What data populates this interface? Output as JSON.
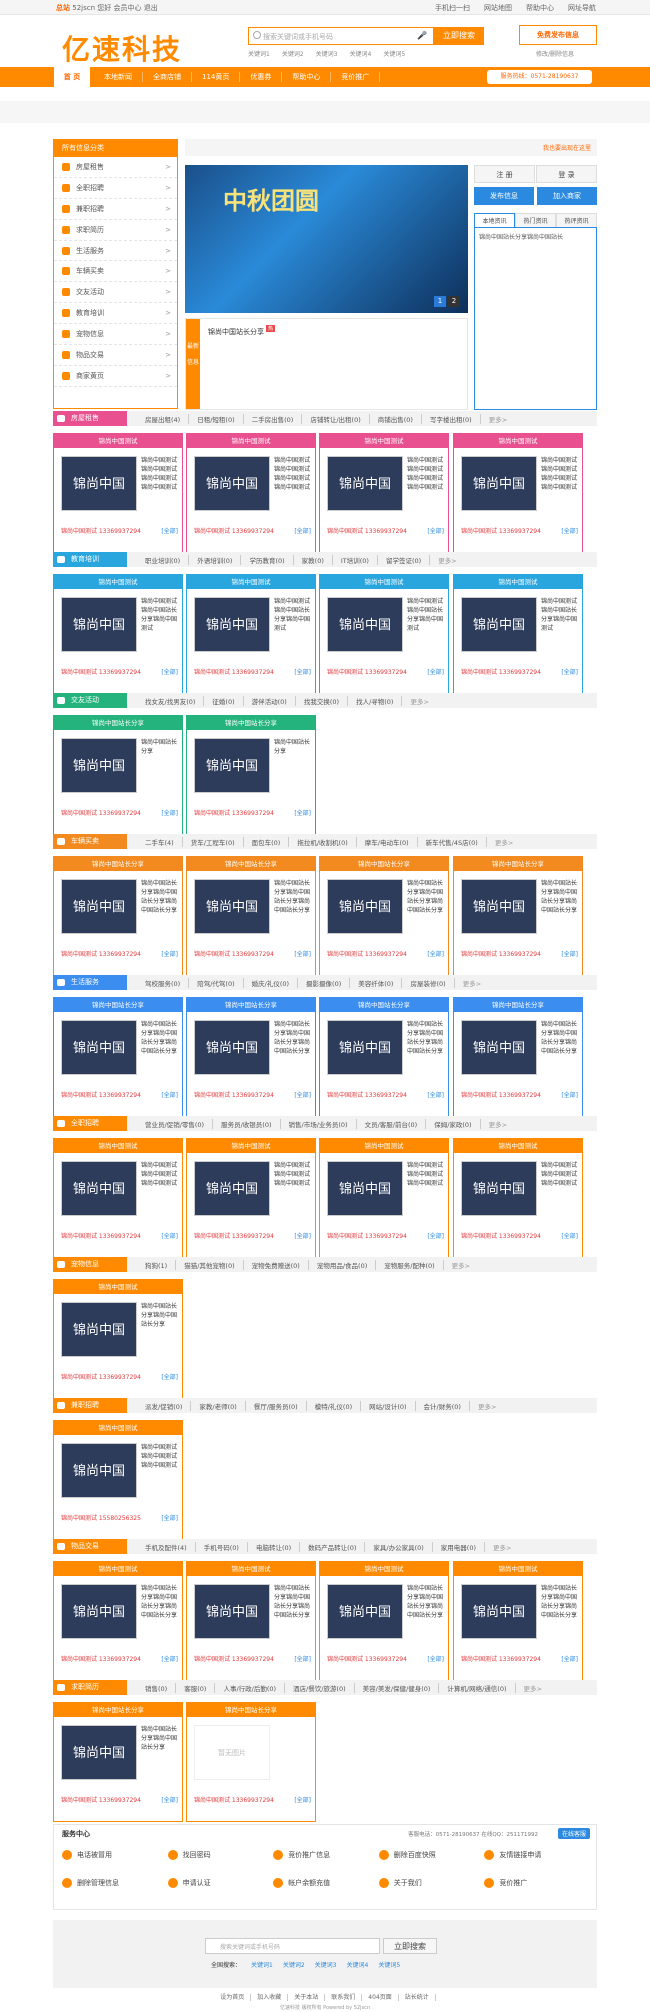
{
  "topbar": {
    "site": "总站",
    "left_text": "52jscn 您好 会员中心 退出",
    "links": [
      "手机扫一扫",
      "网站地图",
      "帮助中心",
      "网址导航"
    ]
  },
  "logo": "亿速科技",
  "search": {
    "placeholder": "搜索关键词或手机号码",
    "button": "立即搜索",
    "hot": [
      "关键词1",
      "关键词2",
      "关键词3",
      "关键词4",
      "关键词5"
    ]
  },
  "publish": {
    "label": "免费发布信息",
    "sub": "修改/删除信息"
  },
  "nav": {
    "home": "首 页",
    "items": [
      "本地新闻",
      "全商店铺",
      "114黄页",
      "优惠券",
      "帮助中心",
      "竞价推广"
    ],
    "tel": "服务热线：0571-28190637"
  },
  "sidebar": {
    "title": "所有信息分类",
    "items": [
      "房屋租售",
      "全职招聘",
      "兼职招聘",
      "求职简历",
      "生活服务",
      "车辆买卖",
      "交友活动",
      "教育培训",
      "宠物信息",
      "物品交易",
      "商家黄页"
    ]
  },
  "location": "我也要出现在这里",
  "banner": {
    "headline": "中秋团圆",
    "pages": [
      "1",
      "2"
    ]
  },
  "news": {
    "tab": "最新信息",
    "item": "锦尚中国站长分享",
    "badge": "热"
  },
  "rightbox": {
    "login": "注 册",
    "register": "登 录",
    "post": "发布信息",
    "join": "加入商家",
    "tabs": [
      "本地资讯",
      "热门资讯",
      "热评资讯"
    ],
    "list_item": "锦尚中国站长分享锦尚中国站长"
  },
  "sections": [
    {
      "title": "房屋租售",
      "color": "#e8508f",
      "subs": [
        "房屋出租(4)",
        "日租/短租(0)",
        "二手房出售(0)",
        "店铺转让/出租(0)",
        "商铺出售(0)",
        "写字楼出租(0)"
      ],
      "cards": 4,
      "header": "锦尚中国测试",
      "desc": "锦尚中国测试锦尚中国测试锦尚中国测试锦尚中国测试",
      "contact": "锦尚中国测试 13369937294"
    },
    {
      "title": "教育培训",
      "color": "#2aa6df",
      "subs": [
        "职业培训(0)",
        "外语培训(0)",
        "学历教育(0)",
        "家教(0)",
        "IT培训(0)",
        "留学签证(0)"
      ],
      "cards": 4,
      "header": "锦尚中国测试",
      "desc": "锦尚中国测试锦尚中国站长分享锦尚中国测试",
      "contact": "锦尚中国测试 13369937294"
    },
    {
      "title": "交友活动",
      "color": "#24b37c",
      "subs": [
        "找女友/找男友(0)",
        "征婚(0)",
        "游伴活动(0)",
        "找我交换(0)",
        "找人/寻物(0)"
      ],
      "cards": 2,
      "header": "锦尚中国站长分享",
      "desc": "锦尚中国站长分享",
      "contact": "锦尚中国测试 13369937294"
    },
    {
      "title": "车辆买卖",
      "color": "#f28a1f",
      "subs": [
        "二手车(4)",
        "货车/工程车(0)",
        "面包车(0)",
        "拖拉机/收割机(0)",
        "摩车/电动车(0)",
        "新车代售/4S店(0)"
      ],
      "cards": 4,
      "header": "锦尚中国站长分享",
      "desc": "锦尚中国站长分享锦尚中国站长分享锦尚中国站长分享",
      "contact": "锦尚中国测试 13369937294"
    },
    {
      "title": "生活服务",
      "color": "#3b8ef0",
      "subs": [
        "驾校服务(0)",
        "陪驾/代驾(0)",
        "婚庆/礼仪(0)",
        "摄影摄像(0)",
        "美容纤体(0)",
        "房屋装修(0)"
      ],
      "cards": 4,
      "header": "锦尚中国站长分享",
      "desc": "锦尚中国站长分享锦尚中国站长分享锦尚中国站长分享",
      "contact": "锦尚中国测试 13369937294"
    },
    {
      "title": "全职招聘",
      "color": "#ff8a00",
      "subs": [
        "营业员/促销/零售(0)",
        "服务员/收银员(0)",
        "销售/市场/业务员(0)",
        "文员/客服/前台(0)",
        "保姆/家政(0)"
      ],
      "cards": 4,
      "header": "锦尚中国测试",
      "desc": "锦尚中国测试锦尚中国测试锦尚中国测试",
      "contact": "锦尚中国测试 13369937294"
    },
    {
      "title": "宠物信息",
      "color": "#ff8a00",
      "subs": [
        "狗狗(1)",
        "猫猫/其他宠物(0)",
        "宠物免费赠送(0)",
        "宠物用品/食品(0)",
        "宠物服务/配种(0)"
      ],
      "cards": 1,
      "header": "锦尚中国测试",
      "desc": "锦尚中国站长分享锦尚中国站长分享",
      "contact": "锦尚中国测试 13369937294"
    },
    {
      "title": "兼职招聘",
      "color": "#ff8a00",
      "subs": [
        "派发/促销(0)",
        "家教/老师(0)",
        "餐厅/服务员(0)",
        "模特/礼仪(0)",
        "网站/设计(0)",
        "会计/财务(0)"
      ],
      "cards": 1,
      "header": "锦尚中国测试",
      "desc": "锦尚中国测试锦尚中国测试锦尚中国测试",
      "contact": "锦尚中国测试 15580256325"
    },
    {
      "title": "物品交易",
      "color": "#ff8a00",
      "subs": [
        "手机及配件(4)",
        "手机号码(0)",
        "电脑转让(0)",
        "数码产品转让(0)",
        "家具/办公家具(0)",
        "家用电器(0)"
      ],
      "cards": 4,
      "header": "锦尚中国测试",
      "desc": "锦尚中国站长分享锦尚中国站长分享锦尚中国站长分享",
      "contact": "锦尚中国测试 13369937294"
    },
    {
      "title": "求职简历",
      "color": "#ff8a00",
      "subs": [
        "销售(0)",
        "客服(0)",
        "人事/行政/后勤(0)",
        "酒店/餐饮/旅游(0)",
        "美容/美发/保健/健身(0)",
        "计算机/网络/通信(0)"
      ],
      "cards": 2,
      "header": "锦尚中国站长分享",
      "desc": "锦尚中国站长分享锦尚中国站长分享",
      "contact": "锦尚中国测试 13369937294"
    }
  ],
  "card_image_text": "锦尚中国",
  "placeholder_text": "暂无图片",
  "all_label": "[全部]",
  "service": {
    "title": "服务中心",
    "tel": "客服电话：0571-28190637  在线QQ：251171992",
    "kefu": "在线客服",
    "items": [
      "电话被冒用",
      "找回密码",
      "竞价推广信息",
      "删除百度快照",
      "友情链接申请",
      "删除管理信息",
      "申请认证",
      "帐户余额充值",
      "关于我们",
      "竞价推广"
    ]
  },
  "footer": {
    "placeholder": "搜索关键词或手机号码",
    "button": "立即搜索",
    "hot_label": "全国搜索：",
    "hot": [
      "关键词1",
      "关键词2",
      "关键词3",
      "关键词4",
      "关键词5"
    ],
    "links": [
      "设为首页",
      "加入收藏",
      "关于本站",
      "联系我们",
      "404页面",
      "站长统计"
    ],
    "copyright": "亿速科技 版权所有 Powered by 52jscn"
  }
}
